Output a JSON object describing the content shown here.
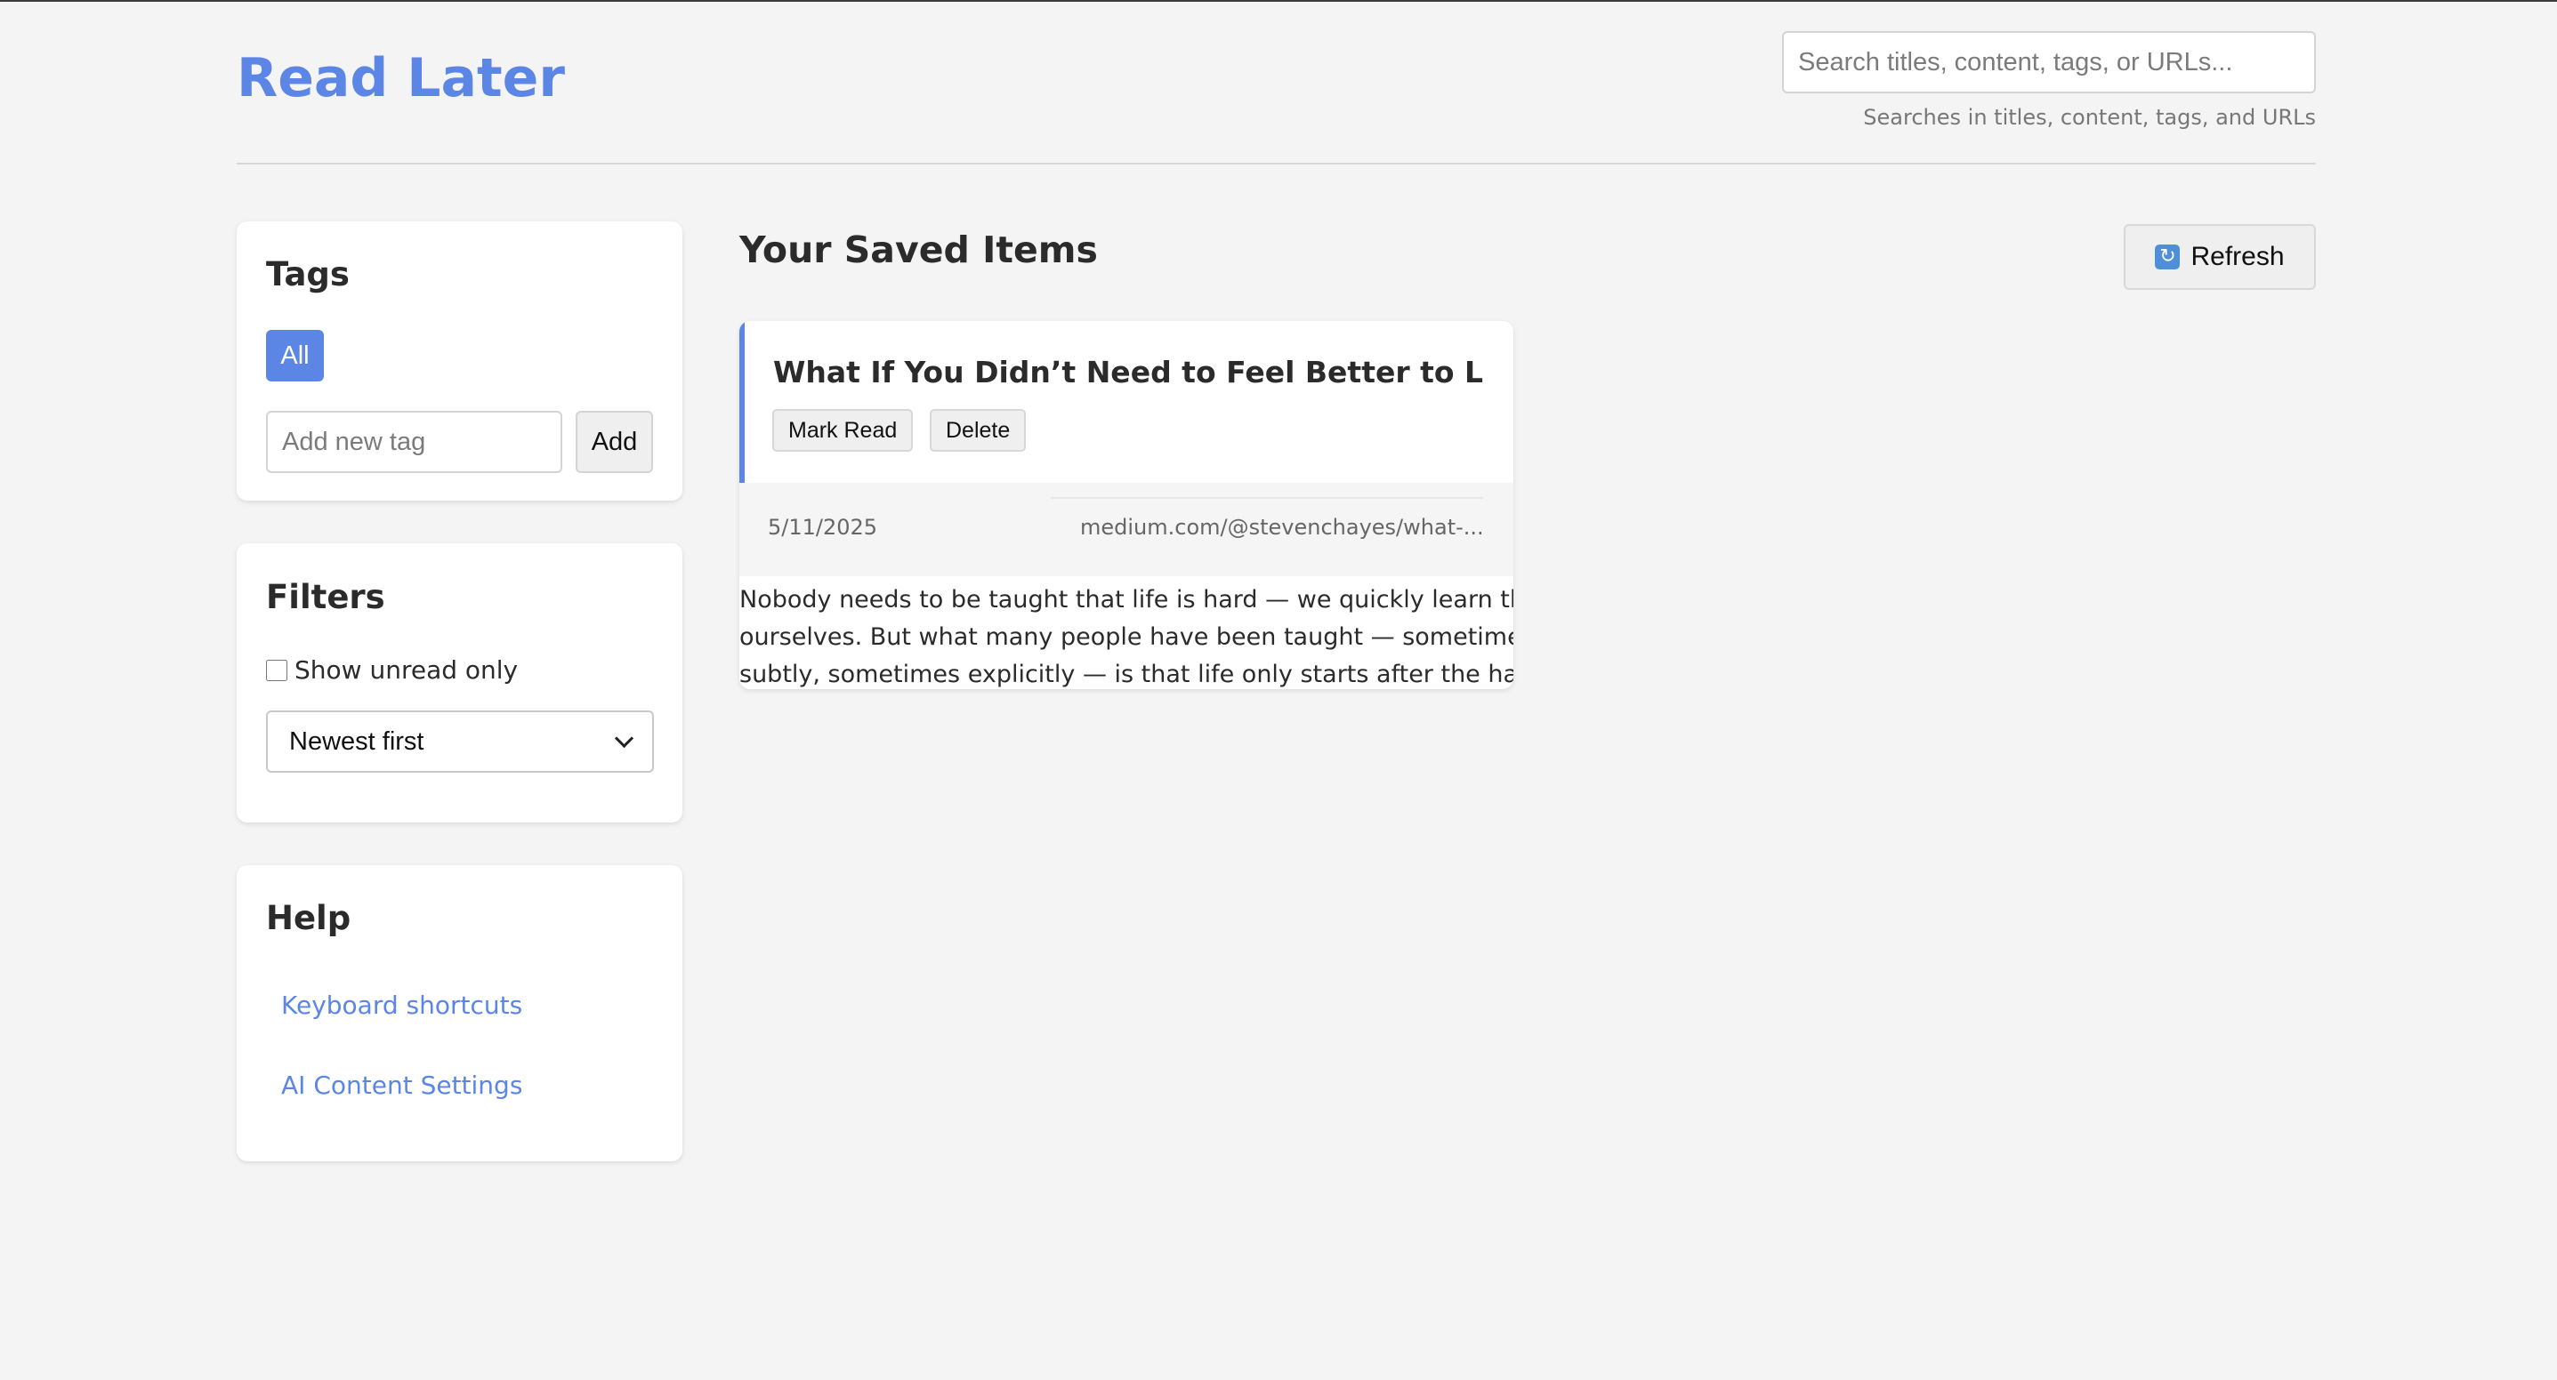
{
  "app": {
    "title": "Read Later"
  },
  "search": {
    "placeholder": "Search titles, content, tags, or URLs...",
    "value": "",
    "hint": "Searches in titles, content, tags, and URLs"
  },
  "sidebar": {
    "tags": {
      "heading": "Tags",
      "items": [
        {
          "label": "All",
          "active": true
        }
      ],
      "new_tag_placeholder": "Add new tag",
      "add_label": "Add"
    },
    "filters": {
      "heading": "Filters",
      "unread_only_label": "Show unread only",
      "unread_only_checked": false,
      "sort_selected": "Newest first"
    },
    "help": {
      "heading": "Help",
      "links": [
        {
          "label": "Keyboard shortcuts"
        },
        {
          "label": "AI Content Settings"
        }
      ]
    }
  },
  "main": {
    "heading": "Your Saved Items",
    "refresh_label": "Refresh",
    "refresh_icon": "refresh-icon",
    "items": [
      {
        "title": "What If You Didn’t Need to Feel Better to Live ...",
        "mark_read_label": "Mark Read",
        "delete_label": "Delete",
        "date": "5/11/2025",
        "url": "medium.com/@stevenchayes/what-...",
        "excerpt_lines": [
          "Nobody needs to be taught that life is hard — we quickly learn that",
          "ourselves. But what many people have been taught — sometimes",
          "subtly, sometimes explicitly — is that life only starts after the hard..."
        ]
      }
    ]
  },
  "colors": {
    "accent": "#5b86e5",
    "background": "#f4f4f4",
    "card": "#ffffff"
  }
}
